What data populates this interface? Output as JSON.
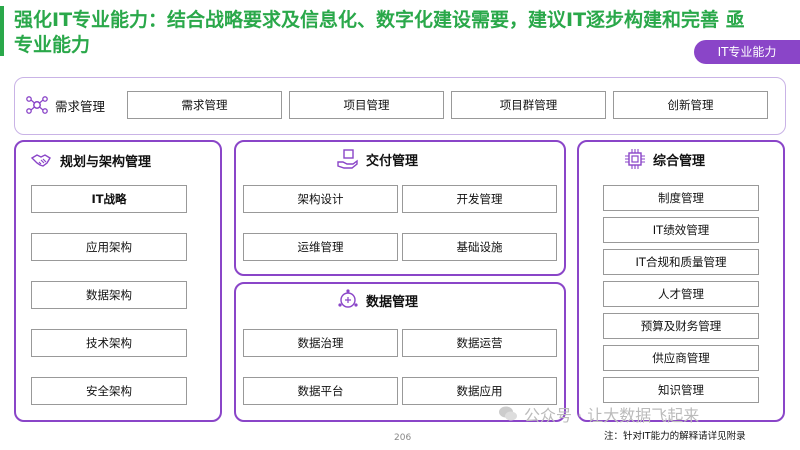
{
  "header": {
    "title": "强化IT专业能力：结合战略要求及信息化、数字化建设需要，建议IT逐步构建和完善 亟专业能力",
    "badge": "IT专业能力"
  },
  "demand": {
    "label": "需求管理",
    "items": [
      "需求管理",
      "项目管理",
      "项目群管理",
      "创新管理"
    ]
  },
  "planning": {
    "label": "规划与架构管理",
    "items": [
      "IT战略",
      "应用架构",
      "数据架构",
      "技术架构",
      "安全架构"
    ]
  },
  "delivery": {
    "label": "交付管理",
    "items": [
      "架构设计",
      "开发管理",
      "运维管理",
      "基础设施"
    ]
  },
  "data_mgmt": {
    "label": "数据管理",
    "items": [
      "数据治理",
      "数据运营",
      "数据平台",
      "数据应用"
    ]
  },
  "comprehensive": {
    "label": "综合管理",
    "items": [
      "制度管理",
      "IT绩效管理",
      "IT合规和质量管理",
      "人才管理",
      "预算及财务管理",
      "供应商管理",
      "知识管理"
    ]
  },
  "footer": {
    "page": "206",
    "watermark": "公众号 · 让大数据飞起来",
    "note": "注：针对IT能力的解释请详见附录"
  },
  "colors": {
    "accent": "#8a45c8",
    "title_green": "#2aa84a"
  }
}
